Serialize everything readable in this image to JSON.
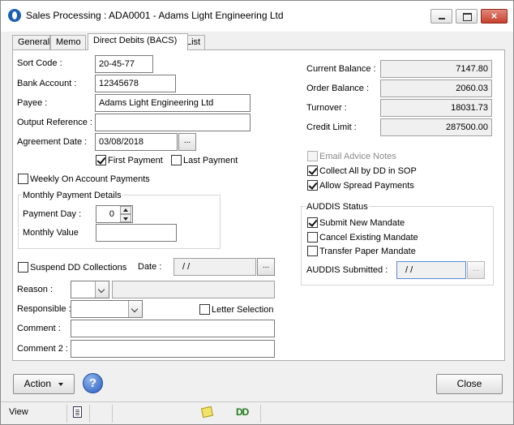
{
  "window": {
    "title": "Sales Processing : ADA0001 - Adams Light Engineering Ltd",
    "close_glyph": "×"
  },
  "tabs": [
    {
      "label": "General"
    },
    {
      "label": "Memo"
    },
    {
      "label": "Direct Debits (BACS)"
    },
    {
      "label": "List"
    }
  ],
  "left": {
    "sort_code_label": "Sort Code :",
    "sort_code_value": "20-45-77",
    "bank_account_label": "Bank Account :",
    "bank_account_value": "12345678",
    "payee_label": "Payee :",
    "payee_value": "Adams Light Engineering Ltd",
    "output_ref_label": "Output Reference :",
    "output_ref_value": "",
    "agreement_date_label": "Agreement Date :",
    "agreement_date_value": "03/08/2018",
    "first_payment_label": "First Payment",
    "first_payment_checked": true,
    "last_payment_label": "Last Payment",
    "last_payment_checked": false,
    "weekly_label": "Weekly On Account Payments",
    "weekly_checked": false,
    "monthly_group_label": "Monthly Payment Details",
    "payment_day_label": "Payment Day :",
    "payment_day_value": "0",
    "monthly_value_label": "Monthly Value",
    "monthly_value": "",
    "suspend_label": "Suspend DD Collections",
    "suspend_checked": false,
    "date_label": "Date :",
    "date_value": "/ /",
    "reason_label": "Reason :",
    "responsible_label": "Responsible :",
    "letter_selection_label": "Letter Selection",
    "letter_selection_checked": false,
    "comment_label": "Comment :",
    "comment2_label": "Comment 2 :"
  },
  "right": {
    "current_balance_label": "Current Balance :",
    "current_balance_value": "7147.80",
    "order_balance_label": "Order Balance :",
    "order_balance_value": "2060.03",
    "turnover_label": "Turnover :",
    "turnover_value": "18031.73",
    "credit_limit_label": "Credit Limit :",
    "credit_limit_value": "287500.00",
    "email_advice_label": "Email Advice Notes",
    "email_advice_checked": false,
    "collect_all_label": "Collect All by DD in SOP",
    "collect_all_checked": true,
    "allow_spread_label": "Allow Spread Payments",
    "allow_spread_checked": true,
    "auddis_group_label": "AUDDIS Status",
    "submit_new_label": "Submit New Mandate",
    "submit_new_checked": true,
    "cancel_existing_label": "Cancel Existing Mandate",
    "cancel_existing_checked": false,
    "transfer_paper_label": "Transfer Paper Mandate",
    "transfer_paper_checked": false,
    "auddis_submitted_label": "AUDDIS Submitted :",
    "auddis_submitted_value": "/ /"
  },
  "footer": {
    "action_label": "Action",
    "help_glyph": "?",
    "close_label": "Close"
  },
  "statusbar": {
    "mode": "View",
    "dd_glyph": "DD"
  },
  "ellipsis": "..."
}
